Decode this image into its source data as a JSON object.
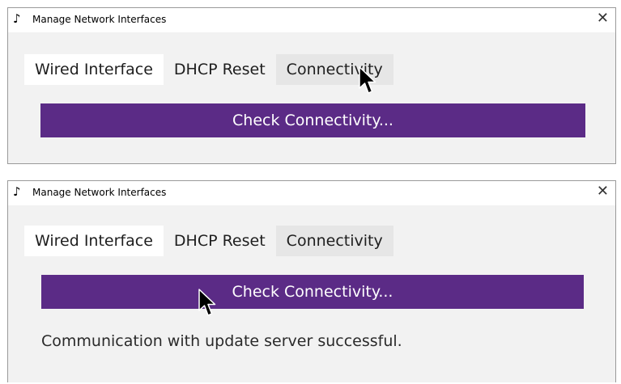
{
  "windows": [
    {
      "title": "Manage Network Interfaces",
      "app_icon": "music-note-icon",
      "close_glyph": "✕",
      "tabs": [
        {
          "label": "Wired Interface"
        },
        {
          "label": "DHCP Reset"
        },
        {
          "label": "Connectivity"
        }
      ],
      "active_tab": "Connectivity",
      "button_label": "Check Connectivity...",
      "status": ""
    },
    {
      "title": "Manage Network Interfaces",
      "app_icon": "music-note-icon",
      "close_glyph": "✕",
      "tabs": [
        {
          "label": "Wired Interface"
        },
        {
          "label": "DHCP Reset"
        },
        {
          "label": "Connectivity"
        }
      ],
      "active_tab": "Connectivity",
      "button_label": "Check Connectivity...",
      "status": "Communication with update server successful."
    }
  ],
  "colors": {
    "button_bg": "#5b2b86",
    "button_text": "#ffffff",
    "window_bg": "#f2f2f2",
    "titlebar_bg": "#ffffff",
    "active_tab_bg": "#e6e6e6"
  }
}
